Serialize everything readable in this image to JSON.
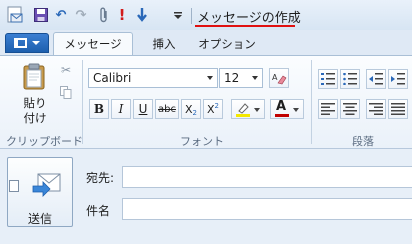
{
  "title_bar": {
    "title": "メッセージの作成",
    "icons": [
      "mail-app-icon",
      "save-icon",
      "undo-icon",
      "redo-icon",
      "attach-icon",
      "high-importance-icon",
      "low-importance-icon",
      "customize-arrow-icon"
    ],
    "accent": "#e01010"
  },
  "tabs": [
    {
      "label": "メッセージ",
      "active": true
    },
    {
      "label": "挿入",
      "active": false
    },
    {
      "label": "オプション",
      "active": false
    }
  ],
  "ribbon": {
    "clipboard": {
      "paste_label": "貼り付け",
      "group_label": "クリップボード",
      "icons": [
        "paste-icon",
        "cut-icon",
        "copy-icon"
      ]
    },
    "font": {
      "font_name": "Calibri",
      "font_size": "12",
      "group_label": "フォント",
      "bold": "B",
      "italic": "I",
      "underline": "U",
      "strike": "abc",
      "subscript": "X",
      "subscript_mark": "2",
      "superscript": "X",
      "superscript_mark": "2",
      "font_color_letter": "A",
      "highlight_color": "#f4e800",
      "font_color": "#c00000"
    },
    "paragraph": {
      "group_label": "段落",
      "icons": [
        "numbered-list-icon",
        "bulleted-list-icon",
        "decrease-indent-icon",
        "increase-indent-icon",
        "align-left-icon",
        "align-center-icon",
        "align-right-icon",
        "justify-icon"
      ]
    }
  },
  "compose": {
    "send_label": "送信",
    "to_label": "宛先:",
    "to_value": "",
    "subject_label": "件名",
    "subject_value": ""
  },
  "colors": {
    "file_tab": "#2b6dbf",
    "ribbon_bg": "#eaf1f9",
    "window_bg": "#dfe9f5"
  }
}
